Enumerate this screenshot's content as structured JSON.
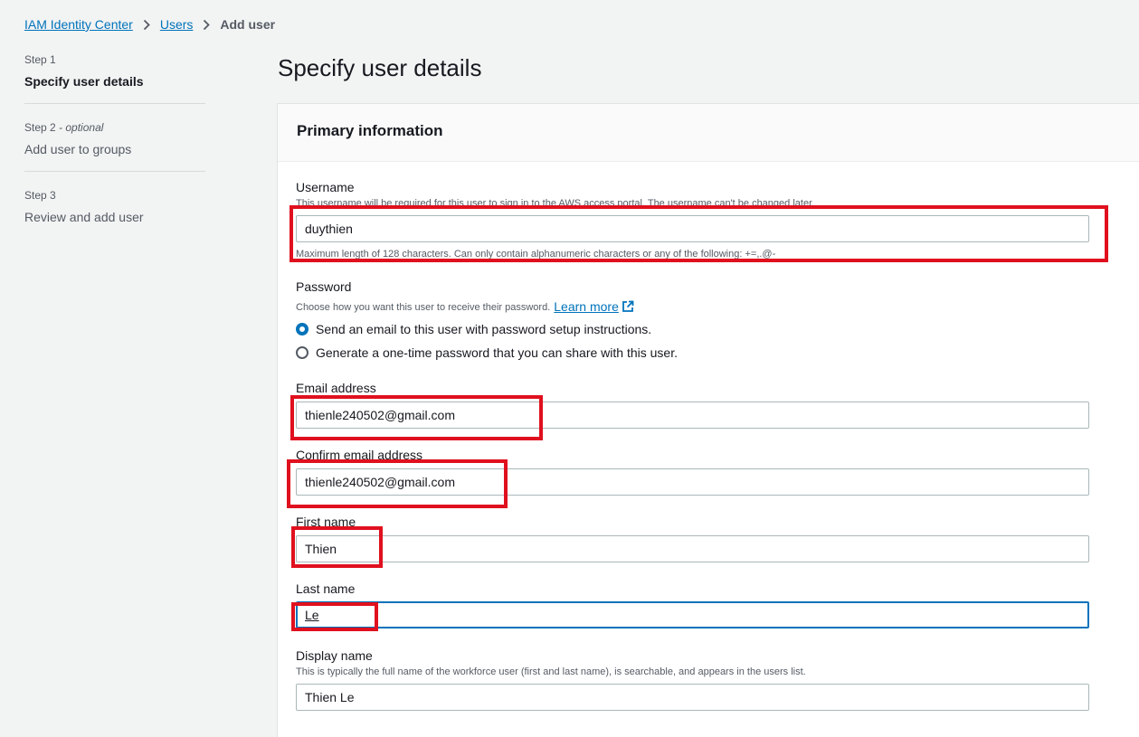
{
  "breadcrumb": {
    "items": [
      "IAM Identity Center",
      "Users"
    ],
    "current": "Add user"
  },
  "steps": [
    {
      "num": "Step 1",
      "optional": "",
      "title": "Specify user details"
    },
    {
      "num": "Step 2",
      "optional": "- optional",
      "title": "Add user to groups"
    },
    {
      "num": "Step 3",
      "optional": "",
      "title": "Review and add user"
    }
  ],
  "page": {
    "title": "Specify user details"
  },
  "panel": {
    "title": "Primary information"
  },
  "form": {
    "username": {
      "label": "Username",
      "description": "This username will be required for this user to sign in to the AWS access portal. The username can't be changed later.",
      "value": "duythien",
      "constraint": "Maximum length of 128 characters. Can only contain alphanumeric characters or any of the following: +=,.@-"
    },
    "password": {
      "label": "Password",
      "description": "Choose how you want this user to receive their password.",
      "learn_more": "Learn more",
      "options": [
        "Send an email to this user with password setup instructions.",
        "Generate a one-time password that you can share with this user."
      ],
      "selected": 0
    },
    "email": {
      "label": "Email address",
      "value": "thienle240502@gmail.com"
    },
    "confirm_email": {
      "label": "Confirm email address",
      "value": "thienle240502@gmail.com"
    },
    "first_name": {
      "label": "First name",
      "value": "Thien"
    },
    "last_name": {
      "label": "Last name",
      "value": "Le"
    },
    "display_name": {
      "label": "Display name",
      "description": "This is typically the full name of the workforce user (first and last name), is searchable, and appears in the users list.",
      "value": "Thien Le"
    }
  },
  "colors": {
    "accent": "#0073bb",
    "highlight": "#e0101e",
    "background": "#f2f3f3"
  }
}
